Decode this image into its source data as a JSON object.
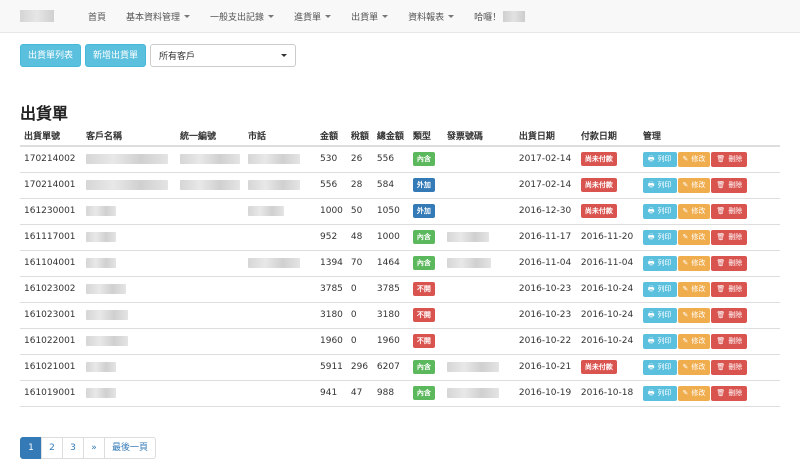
{
  "nav": {
    "home": "首頁",
    "basic_data": "基本資料管理",
    "expense": "一般支出記錄",
    "purchase": "進貨單",
    "shipment": "出貨單",
    "reports": "資料報表",
    "greeting": "哈囉！"
  },
  "toolbar": {
    "list_button": "出貨單列表",
    "new_button": "新增出貨單",
    "customer_select": "所有客戶"
  },
  "page_title": "出貨單",
  "table": {
    "headers": [
      "出貨單號",
      "客戶名稱",
      "統一編號",
      "市話",
      "金額",
      "稅額",
      "總金額",
      "類型",
      "發票號碼",
      "出貨日期",
      "付款日期",
      "管理"
    ],
    "rows": [
      {
        "no": "170214002",
        "amount": "530",
        "tax": "26",
        "total": "556",
        "type": "內含",
        "ship_date": "2017-02-14",
        "pay_date": "尚未付款"
      },
      {
        "no": "170214001",
        "amount": "556",
        "tax": "28",
        "total": "584",
        "type": "外加",
        "ship_date": "2017-02-14",
        "pay_date": "尚未付款"
      },
      {
        "no": "161230001",
        "amount": "1000",
        "tax": "50",
        "total": "1050",
        "type": "外加",
        "ship_date": "2016-12-30",
        "pay_date": "尚未付款"
      },
      {
        "no": "161117001",
        "amount": "952",
        "tax": "48",
        "total": "1000",
        "type": "內含",
        "ship_date": "2016-11-17",
        "pay_date": "2016-11-20"
      },
      {
        "no": "161104001",
        "amount": "1394",
        "tax": "70",
        "total": "1464",
        "type": "內含",
        "ship_date": "2016-11-04",
        "pay_date": "2016-11-04"
      },
      {
        "no": "161023002",
        "amount": "3785",
        "tax": "0",
        "total": "3785",
        "type": "不開",
        "ship_date": "2016-10-23",
        "pay_date": "2016-10-24"
      },
      {
        "no": "161023001",
        "amount": "3180",
        "tax": "0",
        "total": "3180",
        "type": "不開",
        "ship_date": "2016-10-23",
        "pay_date": "2016-10-24"
      },
      {
        "no": "161022001",
        "amount": "1960",
        "tax": "0",
        "total": "1960",
        "type": "不開",
        "ship_date": "2016-10-22",
        "pay_date": "2016-10-24"
      },
      {
        "no": "161021001",
        "amount": "5911",
        "tax": "296",
        "total": "6207",
        "type": "內含",
        "ship_date": "2016-10-21",
        "pay_date": "尚未付款"
      },
      {
        "no": "161019001",
        "amount": "941",
        "tax": "47",
        "total": "988",
        "type": "內含",
        "ship_date": "2016-10-19",
        "pay_date": "2016-10-18"
      }
    ],
    "actions": {
      "print": "列印",
      "edit": "修改",
      "delete": "刪除"
    }
  },
  "pagination": {
    "pages": [
      "1",
      "2",
      "3"
    ],
    "next": "»",
    "last": "最後一頁",
    "active": "1"
  },
  "icons": {
    "print": "printer-icon",
    "edit": "pencil-icon",
    "delete": "trash-icon"
  },
  "colors": {
    "info": "#5bc0de",
    "warning": "#f0ad4e",
    "danger": "#d9534f",
    "success": "#5cb85c",
    "primary": "#337ab7"
  }
}
